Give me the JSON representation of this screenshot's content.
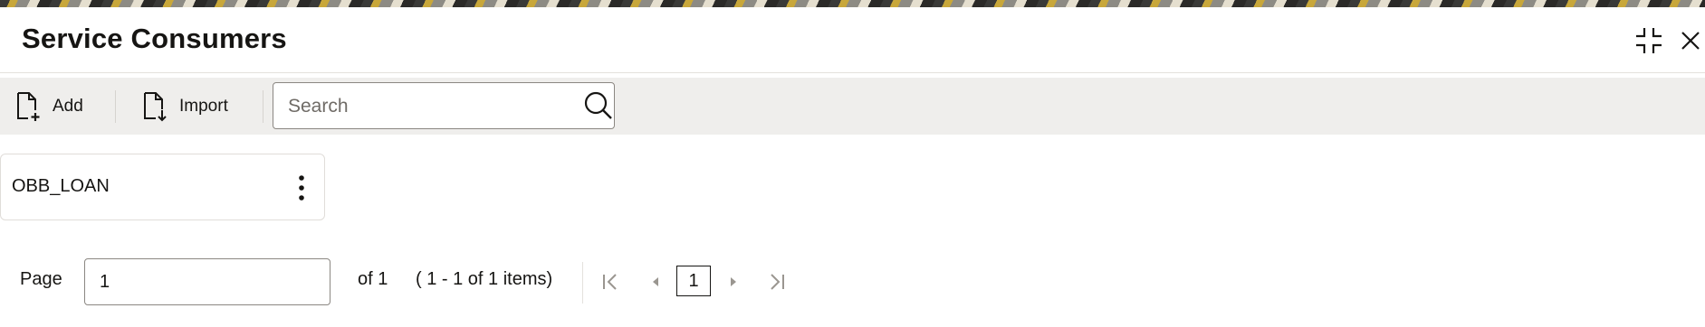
{
  "header": {
    "title": "Service Consumers",
    "minimize_icon": "compress-icon",
    "close_icon": "close-icon"
  },
  "toolbar": {
    "add_label": "Add",
    "add_icon": "document-add-icon",
    "import_label": "Import",
    "import_icon": "document-import-icon",
    "search": {
      "placeholder": "Search",
      "value": "",
      "icon": "search-icon"
    }
  },
  "cards": [
    {
      "name": "OBB_LOAN",
      "menu_icon": "kebab-menu-icon"
    }
  ],
  "pagination": {
    "page_label": "Page",
    "page_value": "1",
    "of_text": "of 1",
    "items_text": "( 1 - 1 of 1 items)",
    "current_page": "1",
    "icons": [
      "first-page-icon",
      "previous-page-icon",
      "next-page-icon",
      "last-page-icon"
    ]
  },
  "colors": {
    "toolbar_bg": "#efeeec",
    "text": "#161513",
    "border": "#8b8782"
  }
}
